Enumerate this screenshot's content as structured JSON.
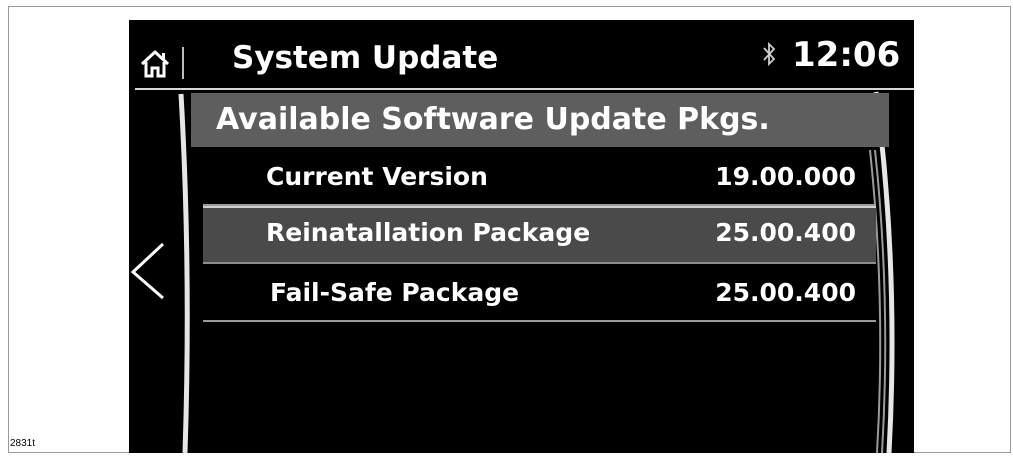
{
  "header": {
    "home_icon": "home-icon",
    "title": "System Update",
    "bluetooth_icon": "bluetooth-icon",
    "time": "12:06"
  },
  "navigation": {
    "back_icon": "chevron-left-icon"
  },
  "list": {
    "heading": "Available Software Update Pkgs.",
    "items": [
      {
        "label": "Current Version",
        "value": "19.00.000",
        "selected": false
      },
      {
        "label": "Reinatallation Package",
        "value": "25.00.400",
        "selected": true
      },
      {
        "label": "Fail-Safe Package",
        "value": "25.00.400",
        "selected": false
      }
    ]
  },
  "figure_id": "2831t",
  "colors": {
    "screen_bg": "#000000",
    "heading_bg": "#5e5e5e",
    "selected_row_bg": "#4a4a4a",
    "text": "#ffffff"
  }
}
